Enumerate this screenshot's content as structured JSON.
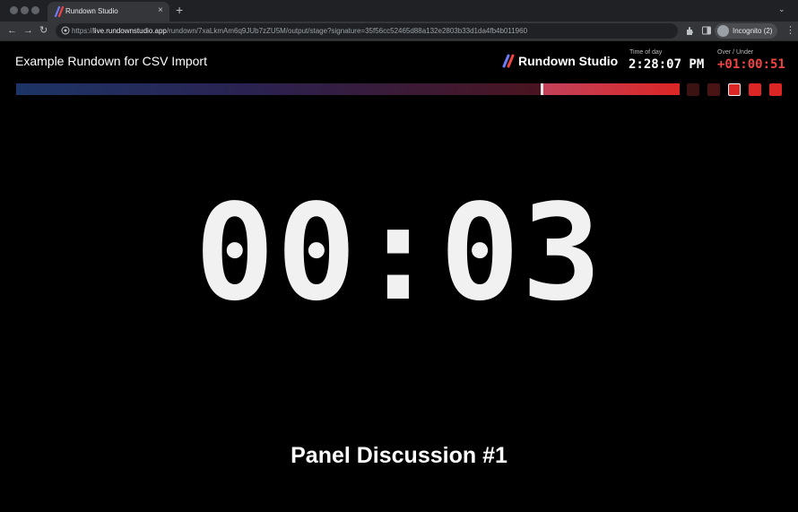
{
  "browser": {
    "tab_title": "Rundown Studio",
    "tab_close": "×",
    "new_tab": "+",
    "tab_menu": "⌄",
    "url_scheme": "https://",
    "url_host": "live.rundownstudio.app",
    "url_path": "/rundown/7xaLkmAm6q9JUb7zZU5M/output/stage?signature=35f56cc52465d88a132e2803b33d1da4fb4b011960",
    "incognito_label": "Incognito (2)",
    "back": "←",
    "forward": "→",
    "reload": "↻",
    "menu": "⋮"
  },
  "stage": {
    "rundown_title": "Example Rundown for CSV Import",
    "brand_name": "Rundown Studio",
    "time_of_day_label": "Time of day",
    "time_of_day": "2:28:07 PM",
    "over_under_label": "Over / Under",
    "over_under": "+01:00:51",
    "countdown": "00:03",
    "current_segment": "Panel Discussion #1",
    "progress_fraction": 0.79
  },
  "colors": {
    "accent_red": "#dc2626",
    "over_under": "#ef4444",
    "background": "#000000"
  },
  "icons": [
    "favicon-icon",
    "close-icon",
    "plus-icon",
    "back-icon",
    "forward-icon",
    "reload-icon",
    "site-info-icon",
    "extensions-icon",
    "side-panel-icon",
    "incognito-icon",
    "kebab-menu-icon",
    "rundown-studio-logo-icon"
  ]
}
